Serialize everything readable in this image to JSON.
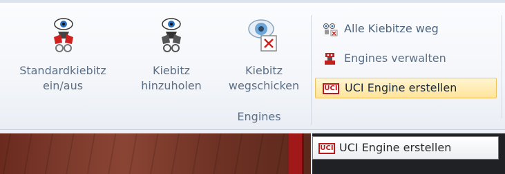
{
  "ribbon": {
    "buttons": [
      {
        "label_line1": "Standardkiebitz",
        "label_line2": "ein/aus",
        "icon": "kibitzer-toggle-icon"
      },
      {
        "label_line1": "Kiebitz",
        "label_line2": "hinzuholen",
        "icon": "kibitzer-add-icon"
      },
      {
        "label_line1": "Kiebitz",
        "label_line2": "wegschicken",
        "icon": "kibitzer-remove-icon"
      }
    ],
    "group_label": "Engines",
    "small_buttons": [
      {
        "label": "Alle Kiebitze weg",
        "icon": "remove-all-kibitzers-icon"
      },
      {
        "label": "Engines verwalten",
        "icon": "manage-engines-icon"
      },
      {
        "label": "UCI Engine erstellen",
        "icon": "uci-icon",
        "badge": "UCI"
      }
    ]
  },
  "tooltip": {
    "text": "UCI Engine erstellen",
    "badge": "UCI"
  },
  "colors": {
    "accent_hover": "#ffe49a",
    "uci_red": "#c01818"
  }
}
